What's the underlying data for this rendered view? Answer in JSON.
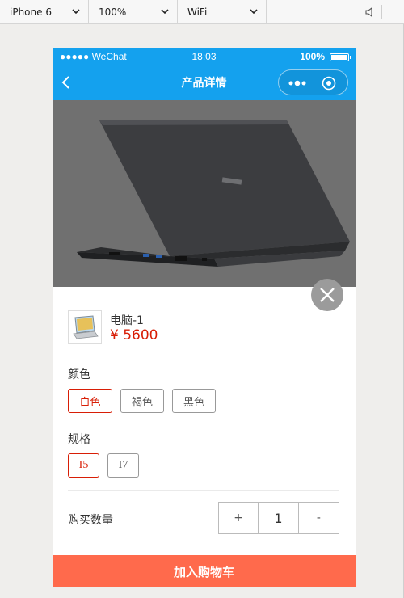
{
  "devtools": {
    "device": "iPhone 6",
    "zoom": "100%",
    "network": "WiFi"
  },
  "statusbar": {
    "carrier": "●●●●● WeChat",
    "time": "18:03",
    "battery": "100%"
  },
  "navbar": {
    "title": "产品详情"
  },
  "banner": {
    "dots_count": 2,
    "active_index": 0
  },
  "product": {
    "name": "电脑-1",
    "price": "¥ 5600"
  },
  "color": {
    "label": "颜色",
    "options": [
      "白色",
      "褐色",
      "黑色"
    ],
    "selected": "白色"
  },
  "spec": {
    "label": "规格",
    "options": [
      "I5",
      "I7"
    ],
    "selected": "I5"
  },
  "quantity": {
    "label": "购买数量",
    "plus": "+",
    "value": "1",
    "minus": "-"
  },
  "cart": {
    "button_label": "加入购物车",
    "color": "#ff6a4c"
  },
  "theme": {
    "accent": "#14a1ee",
    "price_color": "#d81e06"
  }
}
